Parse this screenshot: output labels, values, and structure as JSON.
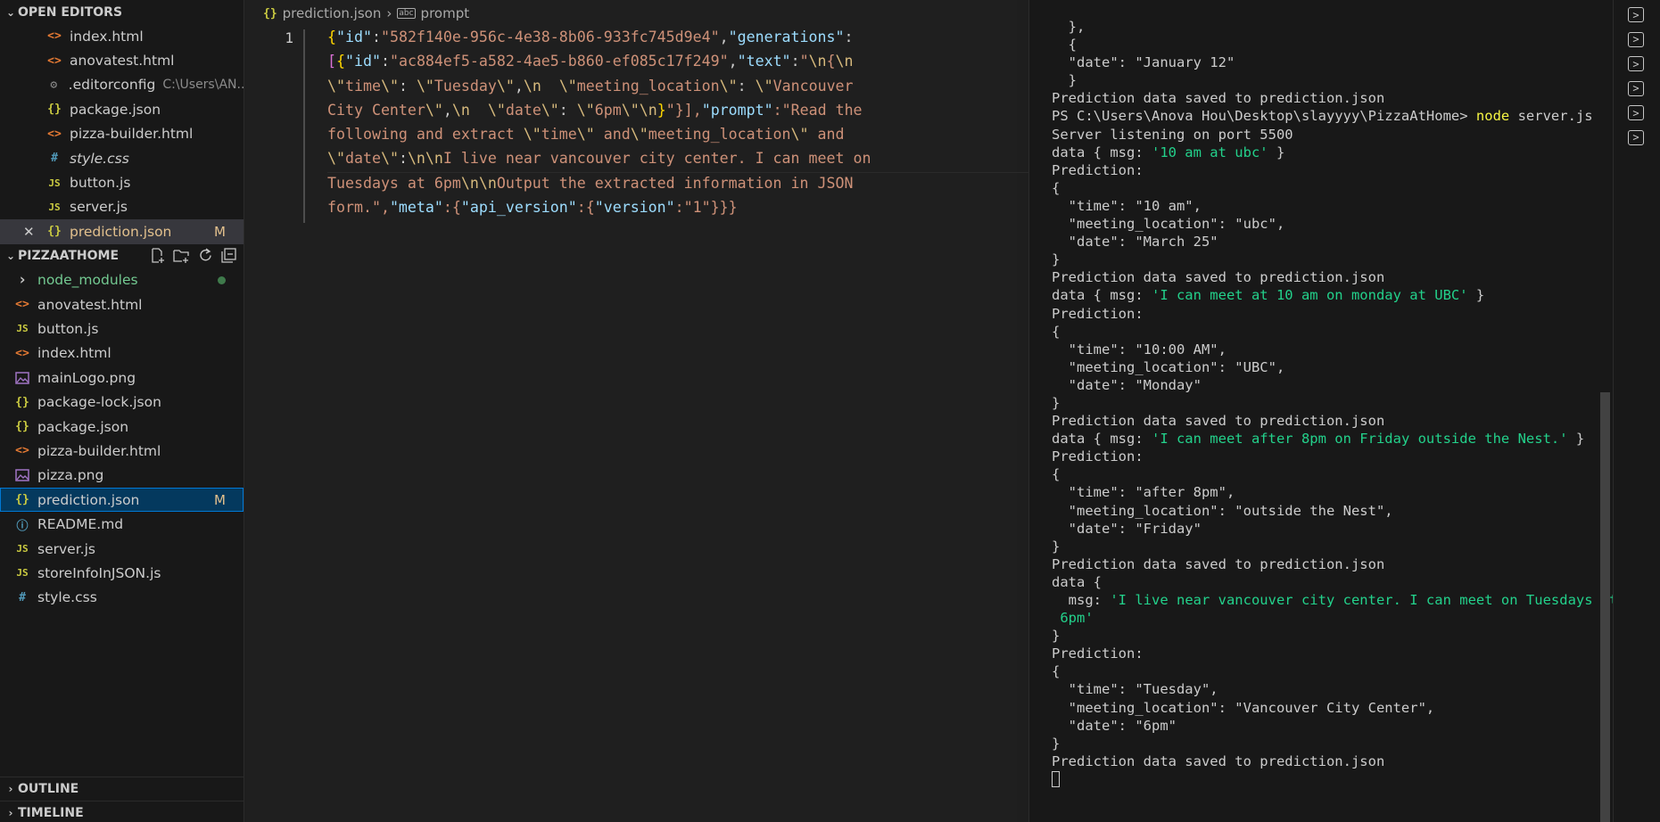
{
  "sidebar": {
    "open_editors": {
      "header": "OPEN EDITORS",
      "items": [
        {
          "name": "index.html",
          "icon": "html-file-icon"
        },
        {
          "name": "anovatest.html",
          "icon": "html-file-icon"
        },
        {
          "name": ".editorconfig",
          "desc": "C:\\Users\\AN...",
          "icon": "gear-icon"
        },
        {
          "name": "package.json",
          "icon": "json-file-icon"
        },
        {
          "name": "pizza-builder.html",
          "icon": "html-file-icon"
        },
        {
          "name": "style.css",
          "icon": "css-file-icon"
        },
        {
          "name": "button.js",
          "icon": "js-file-icon"
        },
        {
          "name": "server.js",
          "icon": "js-file-icon"
        },
        {
          "name": "prediction.json",
          "icon": "json-file-icon",
          "badge": "M"
        }
      ]
    },
    "explorer": {
      "header": "PIZZAATHOME",
      "items": [
        {
          "name": "node_modules",
          "icon": "chevron-right-icon"
        },
        {
          "name": "anovatest.html",
          "icon": "html-file-icon"
        },
        {
          "name": "button.js",
          "icon": "js-file-icon"
        },
        {
          "name": "index.html",
          "icon": "html-file-icon"
        },
        {
          "name": "mainLogo.png",
          "icon": "image-file-icon"
        },
        {
          "name": "package-lock.json",
          "icon": "json-file-icon"
        },
        {
          "name": "package.json",
          "icon": "json-file-icon"
        },
        {
          "name": "pizza-builder.html",
          "icon": "html-file-icon"
        },
        {
          "name": "pizza.png",
          "icon": "image-file-icon"
        },
        {
          "name": "prediction.json",
          "icon": "json-file-icon",
          "badge": "M"
        },
        {
          "name": "README.md",
          "icon": "info-icon"
        },
        {
          "name": "server.js",
          "icon": "js-file-icon"
        },
        {
          "name": "storeInfoInJSON.js",
          "icon": "js-file-icon"
        },
        {
          "name": "style.css",
          "icon": "css-file-icon"
        }
      ]
    },
    "outline_header": "OUTLINE",
    "timeline_header": "TIMELINE"
  },
  "icon_glyphs": {
    "html": "<>",
    "json": "{}",
    "js": "JS",
    "css": "#",
    "gear": "⚙",
    "info": "ⓘ"
  },
  "editor": {
    "breadcrumb": {
      "file": "prediction.json",
      "symbol": "prompt"
    },
    "line_number": "1",
    "code_lines": [
      "{\"id\":\"582f140e-956c-4e38-8b06-933fc745d9e4\",\"generations\":",
      "[{\"id\":\"ac884ef5-a582-4ae5-b860-ef085c17f249\",\"text\":\"\\n{\\n",
      "\\\"time\\\": \\\"Tuesday\\\",\\n  \\\"meeting_location\\\": \\\"Vancouver",
      "City Center\\\",\\n  \\\"date\\\": \\\"6pm\\\"\\n}\"}],\"prompt\":\"Read the",
      "following and extract \\\"time\\\" and\\\"meeting_location\\\" and",
      "\\\"date\\\":\\n\\nI live near vancouver city center. I can meet on",
      "Tuesdays at 6pm\\n\\nOutput the extracted information in JSON",
      "form.\",\"meta\":{\"api_version\":{\"version\":\"1\"}}}"
    ]
  },
  "terminal": {
    "lines": [
      [
        {
          "t": "  },"
        }
      ],
      [
        {
          "t": "  {"
        }
      ],
      [
        {
          "t": "  \"date\": \"January 12\""
        }
      ],
      [
        {
          "t": "  }"
        }
      ],
      [
        {
          "t": "Prediction data saved to prediction.json"
        }
      ],
      [
        {
          "t": "PS C:\\Users\\Anova Hou\\Desktop\\slayyyy\\PizzaAtHome> "
        },
        {
          "t": "node",
          "c": "yellow"
        },
        {
          "t": " server.js"
        }
      ],
      [
        {
          "t": "Server listening on port 5500"
        }
      ],
      [
        {
          "t": "data { msg: "
        },
        {
          "t": "'10 am at ubc'",
          "c": "green"
        },
        {
          "t": " }"
        }
      ],
      [
        {
          "t": "Prediction:"
        }
      ],
      [
        {
          "t": "{"
        }
      ],
      [
        {
          "t": "  \"time\": \"10 am\","
        }
      ],
      [
        {
          "t": "  \"meeting_location\": \"ubc\","
        }
      ],
      [
        {
          "t": "  \"date\": \"March 25\""
        }
      ],
      [
        {
          "t": "}"
        }
      ],
      [
        {
          "t": "Prediction data saved to prediction.json"
        }
      ],
      [
        {
          "t": "data { msg: "
        },
        {
          "t": "'I can meet at 10 am on monday at UBC'",
          "c": "green"
        },
        {
          "t": " }"
        }
      ],
      [
        {
          "t": "Prediction:"
        }
      ],
      [
        {
          "t": "{"
        }
      ],
      [
        {
          "t": "  \"time\": \"10:00 AM\","
        }
      ],
      [
        {
          "t": "  \"meeting_location\": \"UBC\","
        }
      ],
      [
        {
          "t": "  \"date\": \"Monday\""
        }
      ],
      [
        {
          "t": "}"
        }
      ],
      [
        {
          "t": "Prediction data saved to prediction.json"
        }
      ],
      [
        {
          "t": "data { msg: "
        },
        {
          "t": "'I can meet after 8pm on Friday outside the Nest.'",
          "c": "green"
        },
        {
          "t": " }"
        }
      ],
      [
        {
          "t": "Prediction:"
        }
      ],
      [
        {
          "t": "{"
        }
      ],
      [
        {
          "t": "  \"time\": \"after 8pm\","
        }
      ],
      [
        {
          "t": "  \"meeting_location\": \"outside the Nest\","
        }
      ],
      [
        {
          "t": "  \"date\": \"Friday\""
        }
      ],
      [
        {
          "t": "}"
        }
      ],
      [
        {
          "t": "Prediction data saved to prediction.json"
        }
      ],
      [
        {
          "t": "data {"
        }
      ],
      [
        {
          "t": "  msg: "
        },
        {
          "t": "'I live near vancouver city center. I can meet on Tuesdays at",
          "c": "green"
        }
      ],
      [
        {
          "t": " 6pm'",
          "c": "green"
        }
      ],
      [
        {
          "t": "}"
        }
      ],
      [
        {
          "t": "Prediction:"
        }
      ],
      [
        {
          "t": "{"
        }
      ],
      [
        {
          "t": "  \"time\": \"Tuesday\","
        }
      ],
      [
        {
          "t": "  \"meeting_location\": \"Vancouver City Center\","
        }
      ],
      [
        {
          "t": "  \"date\": \"6pm\""
        }
      ],
      [
        {
          "t": "}"
        }
      ],
      [
        {
          "t": "Prediction data saved to prediction.json"
        }
      ],
      [
        {
          "t": "",
          "cursor": true
        }
      ]
    ],
    "tab_count": 6,
    "tab_glyph": ">"
  },
  "colors": {
    "accent": "#0078d4",
    "modified": "#e2c08d",
    "terminal_green": "#23d18b",
    "terminal_yellow": "#f5f543"
  }
}
